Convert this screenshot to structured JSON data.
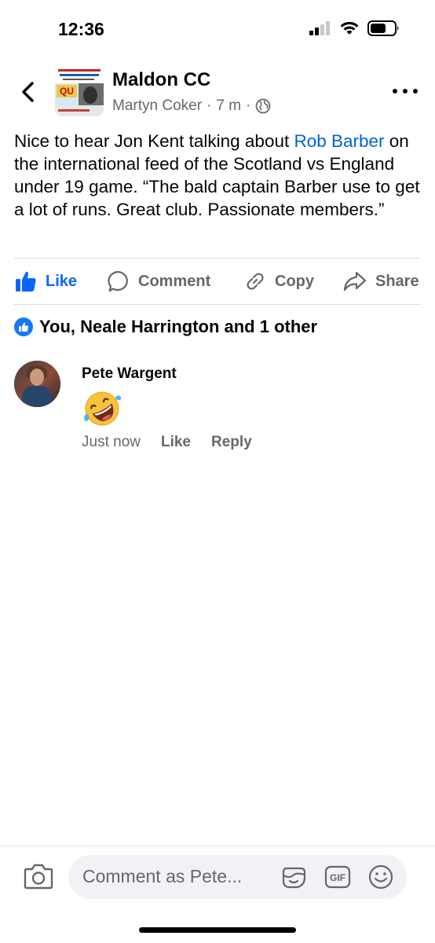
{
  "status_bar": {
    "time": "12:36"
  },
  "header": {
    "group_name": "Maldon CC",
    "author": "Martyn Coker",
    "separator": "·",
    "time_ago": "7 m",
    "audience_icon": "globe-icon",
    "avatar_text": "QU"
  },
  "post": {
    "text_before_link": "Nice to hear Jon Kent talking about ",
    "link_text": "Rob Barber",
    "text_after_link": " on the international feed of the Scotland vs England under 19 game. “The bald captain Barber use to get a lot of runs. Great club. Passionate members.”"
  },
  "actions": {
    "like": "Like",
    "comment": "Comment",
    "copy": "Copy",
    "share": "Share"
  },
  "reactions": {
    "summary": "You, Neale Harrington and 1 other"
  },
  "comment": {
    "author": "Pete Wargent",
    "emoji": "rolling-on-floor-laughing",
    "time": "Just now",
    "like_label": "Like",
    "reply_label": "Reply"
  },
  "composer": {
    "placeholder": "Comment as Pete...",
    "gif_label": "GIF"
  },
  "colors": {
    "accent": "#0866FF",
    "link": "#0064D1",
    "secondary_text": "#65676B",
    "input_bg": "#F0F2F5"
  }
}
